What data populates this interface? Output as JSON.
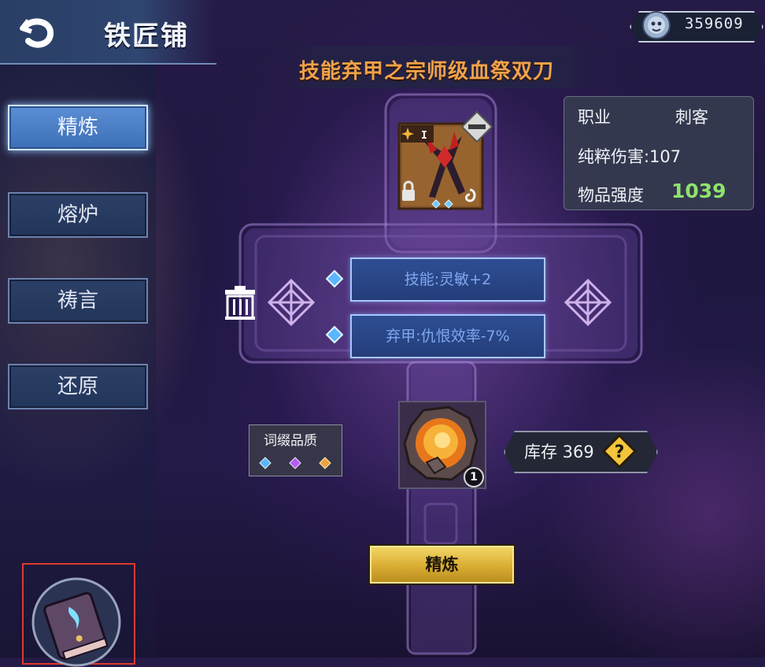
{
  "header": {
    "title": "铁匠铺",
    "back_icon": "back-arrow-icon"
  },
  "currency": {
    "value": "359609",
    "icon": "spirit-currency-icon"
  },
  "item": {
    "name": "技能弃甲之宗师级血祭双刀",
    "rank": "I",
    "locked": true,
    "icon": "dual-daggers-icon"
  },
  "sidebar": {
    "items": [
      {
        "label": "精炼",
        "active": true
      },
      {
        "label": "熔炉",
        "active": false
      },
      {
        "label": "祷言",
        "active": false
      },
      {
        "label": "还原",
        "active": false
      }
    ]
  },
  "stats": {
    "class_label": "职业",
    "class_value": "刺客",
    "damage": "纯粹伤害:107",
    "power_label": "物品强度",
    "power_value": "1039",
    "power_color": "#8fe26b"
  },
  "affixes": [
    {
      "text": "技能:灵敏+2"
    },
    {
      "text": "弃甲:仇恨效率-7%"
    }
  ],
  "affix_quality": {
    "label": "词缀品质",
    "gems": [
      {
        "color": "#5bb5ff"
      },
      {
        "color": "#b35bf2"
      },
      {
        "color": "#f2a23a"
      }
    ]
  },
  "material": {
    "count": "1",
    "icon": "ember-stone-icon"
  },
  "stock": {
    "label": "库存 369"
  },
  "action": {
    "refine_label": "精炼"
  },
  "colors": {
    "accent_blue": "#3d6fb7",
    "title_orange": "#f0a24a",
    "button_gold": "#d9ad32"
  }
}
